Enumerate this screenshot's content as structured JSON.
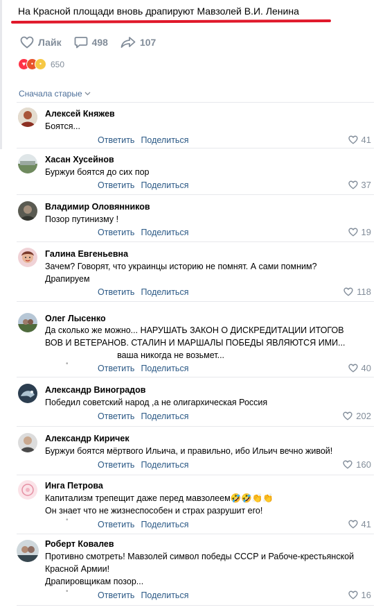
{
  "post": {
    "title": "На Красной площади вновь драпируют Мавзолей В.И. Ленина",
    "like_label": "Лайк",
    "comments_count": "498",
    "shares_count": "107",
    "reactions_count": "650"
  },
  "sort_label": "Сначала старые",
  "reply_label": "Ответить",
  "share_label": "Поделиться",
  "accent_color": "#2a5885",
  "underline_color": "#e0182a",
  "comments": [
    {
      "name": "Алексей Княжев",
      "text": "Боятся...",
      "likes": "41"
    },
    {
      "name": "Хасан Хусейнов",
      "text": "Буржуи боятся до сих пор",
      "likes": "37"
    },
    {
      "name": "Владимир Оловянников",
      "text": "Позор путинизму !",
      "likes": "19"
    },
    {
      "name": "Галина Евгеньевна",
      "text": "Зачем? Говорят, что украинцы историю не помнят. А сами помним?\nДрапируем",
      "likes": "118"
    },
    {
      "name": "Олег Лысенко",
      "text": "Да сколько же можно... НАРУШАТЬ ЗАКОН О ДИСКРЕДИТАЦИИ ИТОГОВ\nВОВ И ВЕТЕРАНОВ. СТАЛИН И МАРШАЛЫ ПОБЕДЫ ЯВЛЯЮТСЯ ИМИ...\n                              ваша никогда не возьмет...",
      "likes": "40"
    },
    {
      "name": "Александр Виноградов",
      "text": "Победил советский народ ,а не олигархическая Россия",
      "likes": "202"
    },
    {
      "name": "Александр Киричек",
      "text": "Буржуи боятся мёртвого Ильича, и правильно, ибо Ильич вечно живой!",
      "likes": "160"
    },
    {
      "name": "Инга Петрова",
      "text": "Капитализм трепещит даже перед мавзолеем🤣🤣👏👏\nОн знает что не жизнеспособен и страх разрушит его!",
      "likes": "41"
    },
    {
      "name": "Роберт Ковалев",
      "text": "Противно смотреть! Мавзолей символ победы СССР и Рабоче-крестьянской\nКрасной Армии!\nДрапировщикам позор...",
      "likes": "16"
    }
  ]
}
